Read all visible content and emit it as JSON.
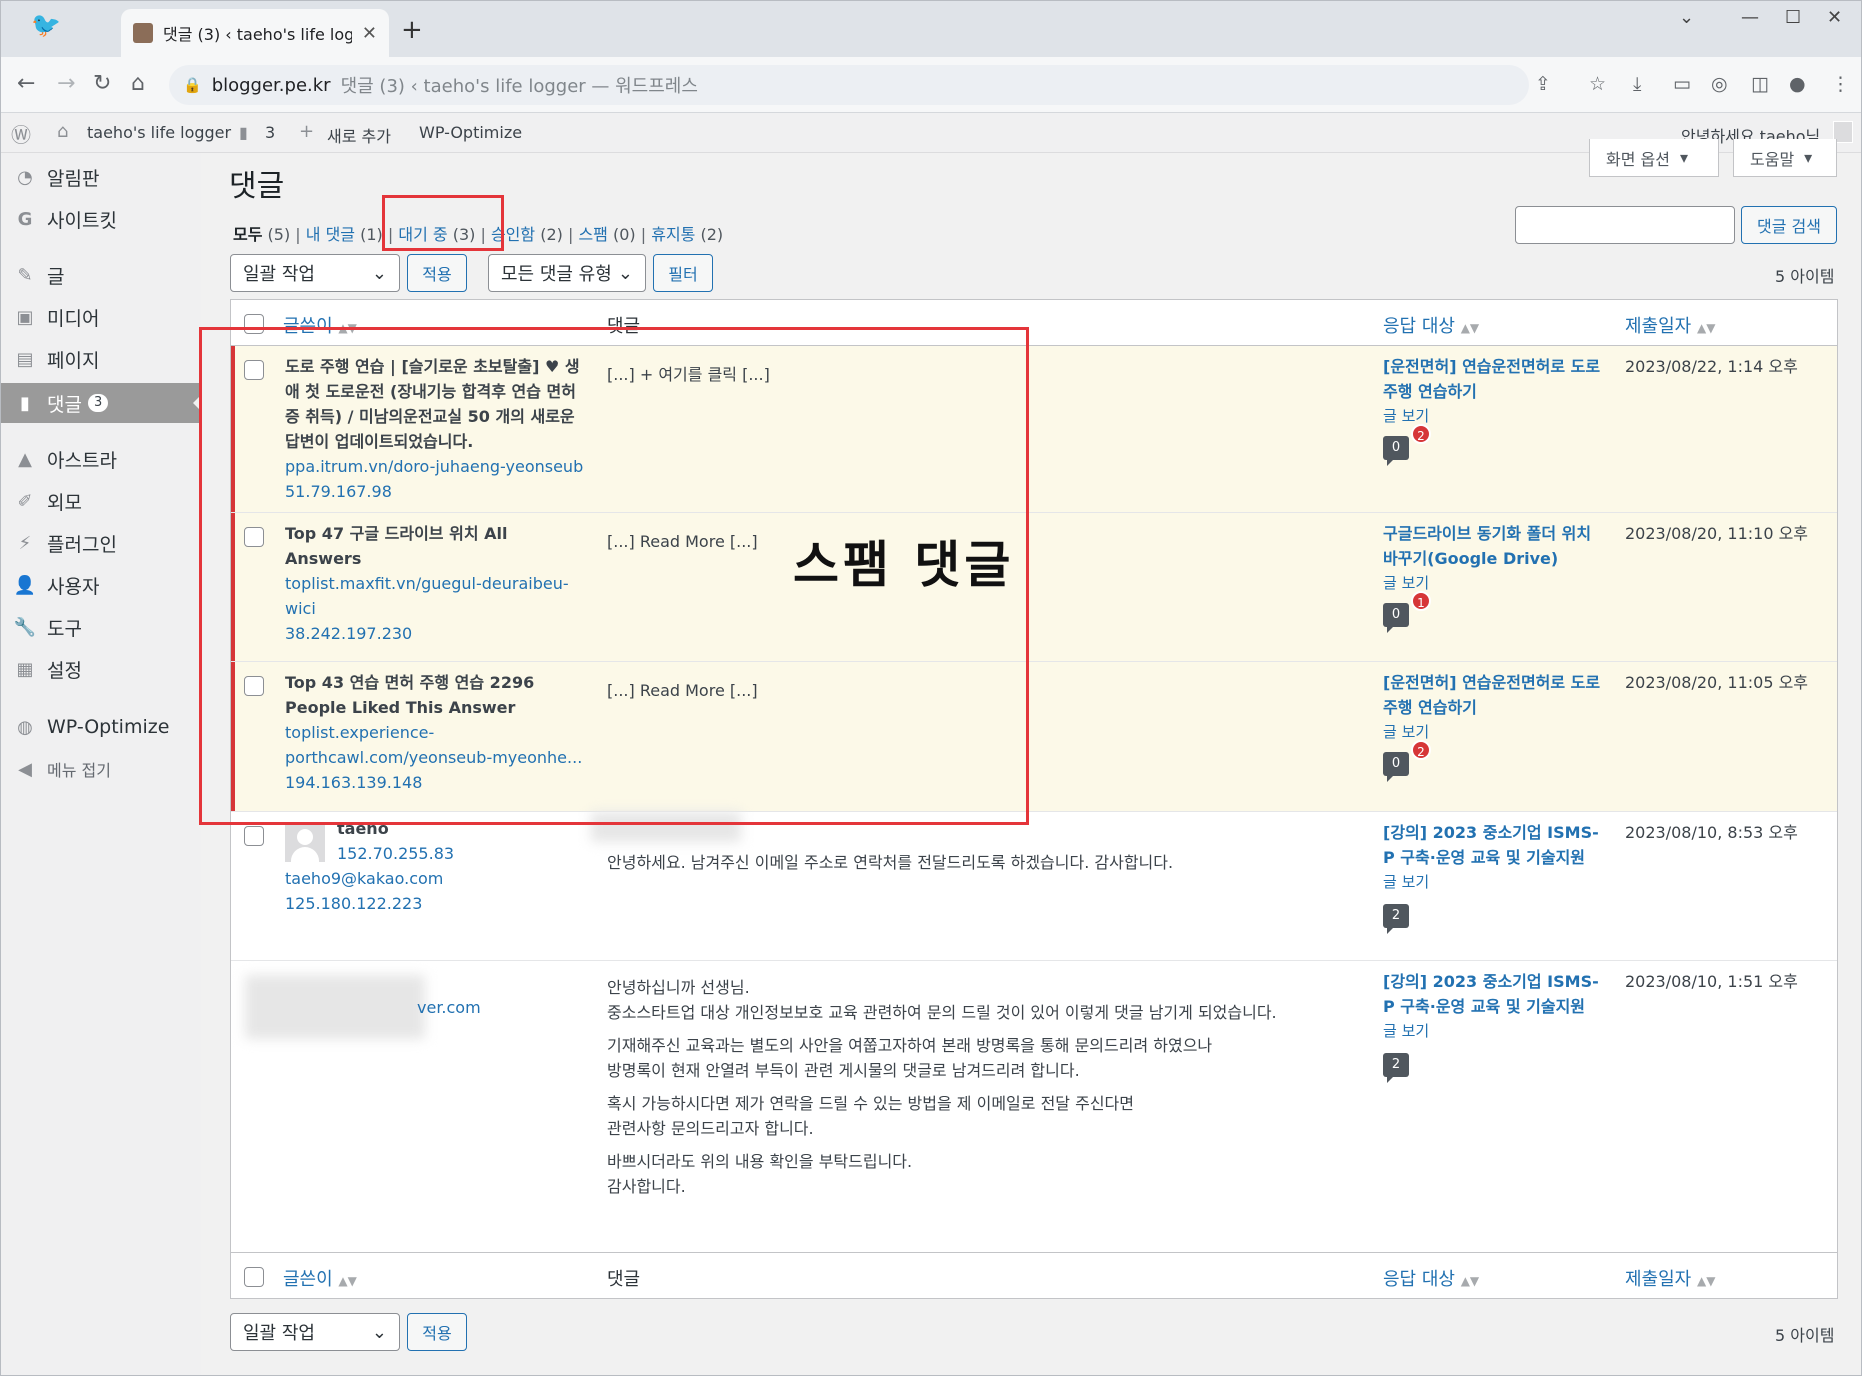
{
  "browser": {
    "tab_title": "댓글 (3) ‹ taeho's life logger —",
    "url_domain": "blogger.pe.kr",
    "page_title": "댓글 (3) ‹ taeho's life logger — 워드프레스"
  },
  "adminbar": {
    "site_name": "taeho's life logger",
    "comments_count": "3",
    "new_label": "새로 추가",
    "plugin": "WP-Optimize",
    "greeting": "안녕하세요 taeho님"
  },
  "sidebar": {
    "items": [
      {
        "label": "알림판",
        "icon": "dashboard-icon"
      },
      {
        "label": "사이트킷",
        "icon": "google-icon"
      },
      {
        "label": "글",
        "icon": "pin-icon"
      },
      {
        "label": "미디어",
        "icon": "media-icon"
      },
      {
        "label": "페이지",
        "icon": "page-icon"
      },
      {
        "label": "댓글",
        "icon": "comment-icon",
        "count": "3"
      },
      {
        "label": "아스트라",
        "icon": "astra-icon"
      },
      {
        "label": "외모",
        "icon": "brush-icon"
      },
      {
        "label": "플러그인",
        "icon": "plugin-icon"
      },
      {
        "label": "사용자",
        "icon": "user-icon"
      },
      {
        "label": "도구",
        "icon": "wrench-icon"
      },
      {
        "label": "설정",
        "icon": "settings-icon"
      },
      {
        "label": "WP-Optimize",
        "icon": "wpo-icon"
      },
      {
        "label": "메뉴 접기",
        "icon": "collapse-icon"
      }
    ]
  },
  "header": {
    "screen_options": "화면 옵션",
    "help": "도움말",
    "title": "댓글"
  },
  "filters": {
    "all": "모두",
    "all_count": "(5)",
    "mine": "내 댓글",
    "mine_count": "(1)",
    "pending": "대기 중",
    "pending_count": "(3)",
    "approved": "승인함",
    "approved_count": "(2)",
    "spam": "스팸",
    "spam_count": "(0)",
    "trash": "휴지통",
    "trash_count": "(2)"
  },
  "toolbar": {
    "bulk_action": "일괄 작업",
    "apply": "적용",
    "comment_type": "모든 댓글 유형",
    "filter": "필터",
    "search_button": "댓글 검색",
    "search_value": "",
    "item_count": "5 아이템"
  },
  "columns": {
    "author": "글쓴이",
    "comment": "댓글",
    "response": "응답 대상",
    "date": "제출일자"
  },
  "rows": [
    {
      "author_name": "도로 주행 연습 | [슬기로운 초보탈출] ♥ 생애 첫 도로운전 (장내기능 합격후 연습 면허증 취득) / 미남의운전교실 50 개의 새로운 답변이 업데이트되었습니다.",
      "author_url": "ppa.itrum.vn/doro-juhaeng-yeonseub",
      "author_ip": "51.79.167.98",
      "comment": "[...] + 여기를 클릭 [...]",
      "response": "[운전면허] 연습운전면허로 도로주행 연습하기",
      "view": "글 보기",
      "bubble": "0",
      "pending": "2",
      "date": "2023/08/22, 1:14 오후"
    },
    {
      "author_name": "Top 47 구글 드라이브 위치 All Answers",
      "author_url": "toplist.maxfit.vn/guegul-deuraibeu-wici",
      "author_ip": "38.242.197.230",
      "comment": "[...] Read More [...]",
      "response": "구글드라이브 동기화 폴더 위치 바꾸기(Google Drive)",
      "view": "글 보기",
      "bubble": "0",
      "pending": "1",
      "date": "2023/08/20, 11:10 오후"
    },
    {
      "author_name": "Top 43 연습 면허 주행 연습 2296 People Liked This Answer",
      "author_url": "toplist.experience-porthcawl.com/yeonseub-myeonhe...",
      "author_ip": "194.163.139.148",
      "comment": "[...] Read More [...]",
      "response": "[운전면허] 연습운전면허로 도로주행 연습하기",
      "view": "글 보기",
      "bubble": "0",
      "pending": "2",
      "date": "2023/08/20, 11:05 오후"
    },
    {
      "author_name": "taeho",
      "author_ip_top": "152.70.255.83",
      "author_email": "taeho9@kakao.com",
      "author_ip": "125.180.122.223",
      "comment": "안녕하세요. 남겨주신 이메일 주소로 연락처를 전달드리도록 하겠습니다. 감사합니다.",
      "response": "[강의] 2023 중소기업 ISMS-P 구축·운영 교육 및 기술지원",
      "view": "글 보기",
      "bubble": "2",
      "date": "2023/08/10, 8:53 오후"
    },
    {
      "author_email_fragment": "ver.com",
      "comment_lines": [
        "안녕하십니까 선생님.",
        "중소스타트업 대상 개인정보보호 교육 관련하여 문의 드릴 것이 있어 이렇게 댓글 남기게 되었습니다.",
        "기재해주신 교육과는 별도의 사안을 여쭙고자하여 본래 방명록을 통해 문의드리려 하였으나",
        "방명록이 현재 안열려 부득이 관련 게시물의 댓글로 남겨드리려 합니다.",
        "혹시 가능하시다면 제가 연락을 드릴 수 있는 방법을 제 이메일로 전달 주신다면",
        "관련사항 문의드리고자 합니다.",
        "바쁘시더라도 위의 내용 확인을 부탁드립니다.",
        "감사합니다."
      ],
      "response": "[강의] 2023 중소기업 ISMS-P 구축·운영 교육 및 기술지원",
      "view": "글 보기",
      "bubble": "2",
      "date": "2023/08/10, 1:51 오후"
    }
  ],
  "annotation": {
    "label": "스팸 댓글",
    "color": "#e4353a"
  },
  "colors": {
    "link": "#2271b1",
    "pending_bg": "#fcf9e8",
    "pending_border": "#d63638"
  }
}
